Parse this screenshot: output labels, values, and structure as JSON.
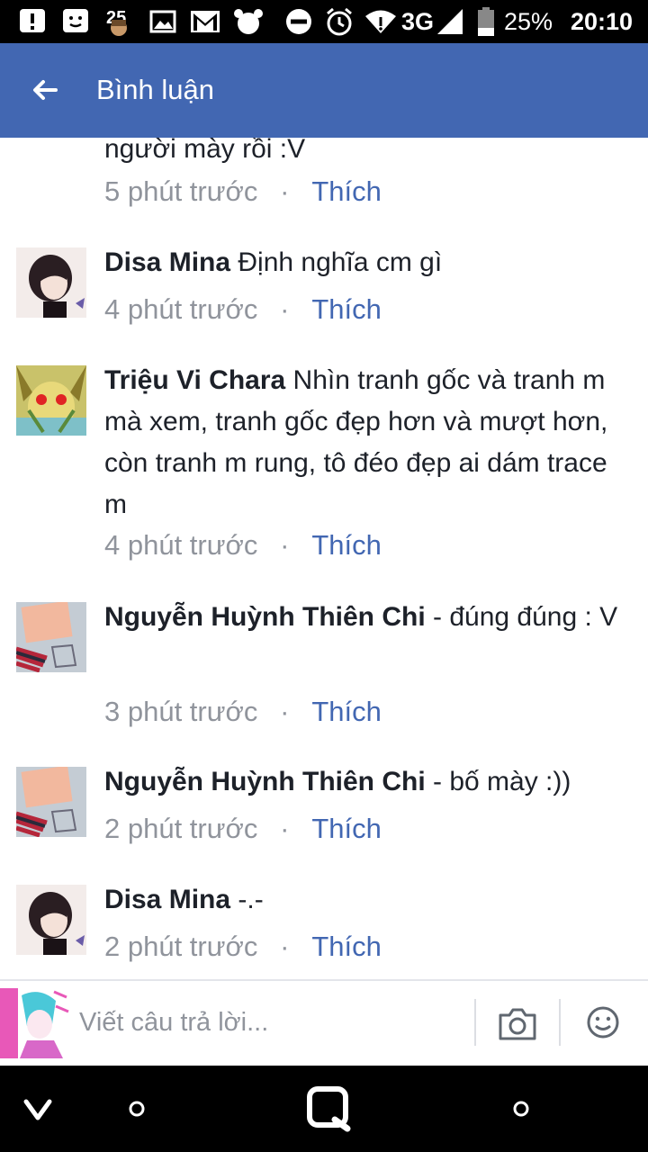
{
  "status_bar": {
    "battery_small": "25",
    "network": "3G",
    "battery_percent": "25%",
    "time": "20:10"
  },
  "header": {
    "title": "Bình luận"
  },
  "comments": [
    {
      "author": "",
      "text": "người mày rồi :V",
      "time": "5 phút trước",
      "like": "Thích",
      "avatar": "none"
    },
    {
      "author": "Disa Mina",
      "text": "Định nghĩa cm gì",
      "time": "4 phút trước",
      "like": "Thích",
      "avatar": "disa-avatar"
    },
    {
      "author": "Triệu Vi Chara",
      "text": "Nhìn tranh gốc và tranh m mà xem, tranh gốc đẹp hơn và mượt hơn, còn tranh m rung, tô đéo đẹp ai dám trace m",
      "time": "4 phút trước",
      "like": "Thích",
      "avatar": "trieu-avatar"
    },
    {
      "author": "Nguyễn Huỳnh Thiên Chi",
      "text": "- đúng đúng : V",
      "time": "3 phút trước",
      "like": "Thích",
      "avatar": "chi-avatar"
    },
    {
      "author": "Nguyễn Huỳnh Thiên Chi",
      "text": "- bố mày :))",
      "time": "2 phút trước",
      "like": "Thích",
      "avatar": "chi-avatar"
    },
    {
      "author": "Disa Mina",
      "text": "-.-",
      "time": "2 phút trước",
      "like": "Thích",
      "avatar": "disa-avatar"
    }
  ],
  "separator": "·",
  "reply": {
    "placeholder": "Viết câu trả lời..."
  },
  "icons": [
    "alert-icon",
    "messenger-icon",
    "gallery-icon",
    "gmail-icon",
    "alarm-icon",
    "dnd-icon",
    "clock-icon",
    "wifi-icon",
    "signal-icon",
    "battery-icon",
    "back-arrow-icon",
    "camera-icon",
    "smile-icon",
    "nav-back-icon",
    "nav-home-icon",
    "nav-search-icon",
    "nav-recent-icon"
  ],
  "colors": {
    "header_bg": "#4267b2",
    "like": "#4267b2",
    "meta": "#90949c",
    "text": "#1d2129"
  }
}
